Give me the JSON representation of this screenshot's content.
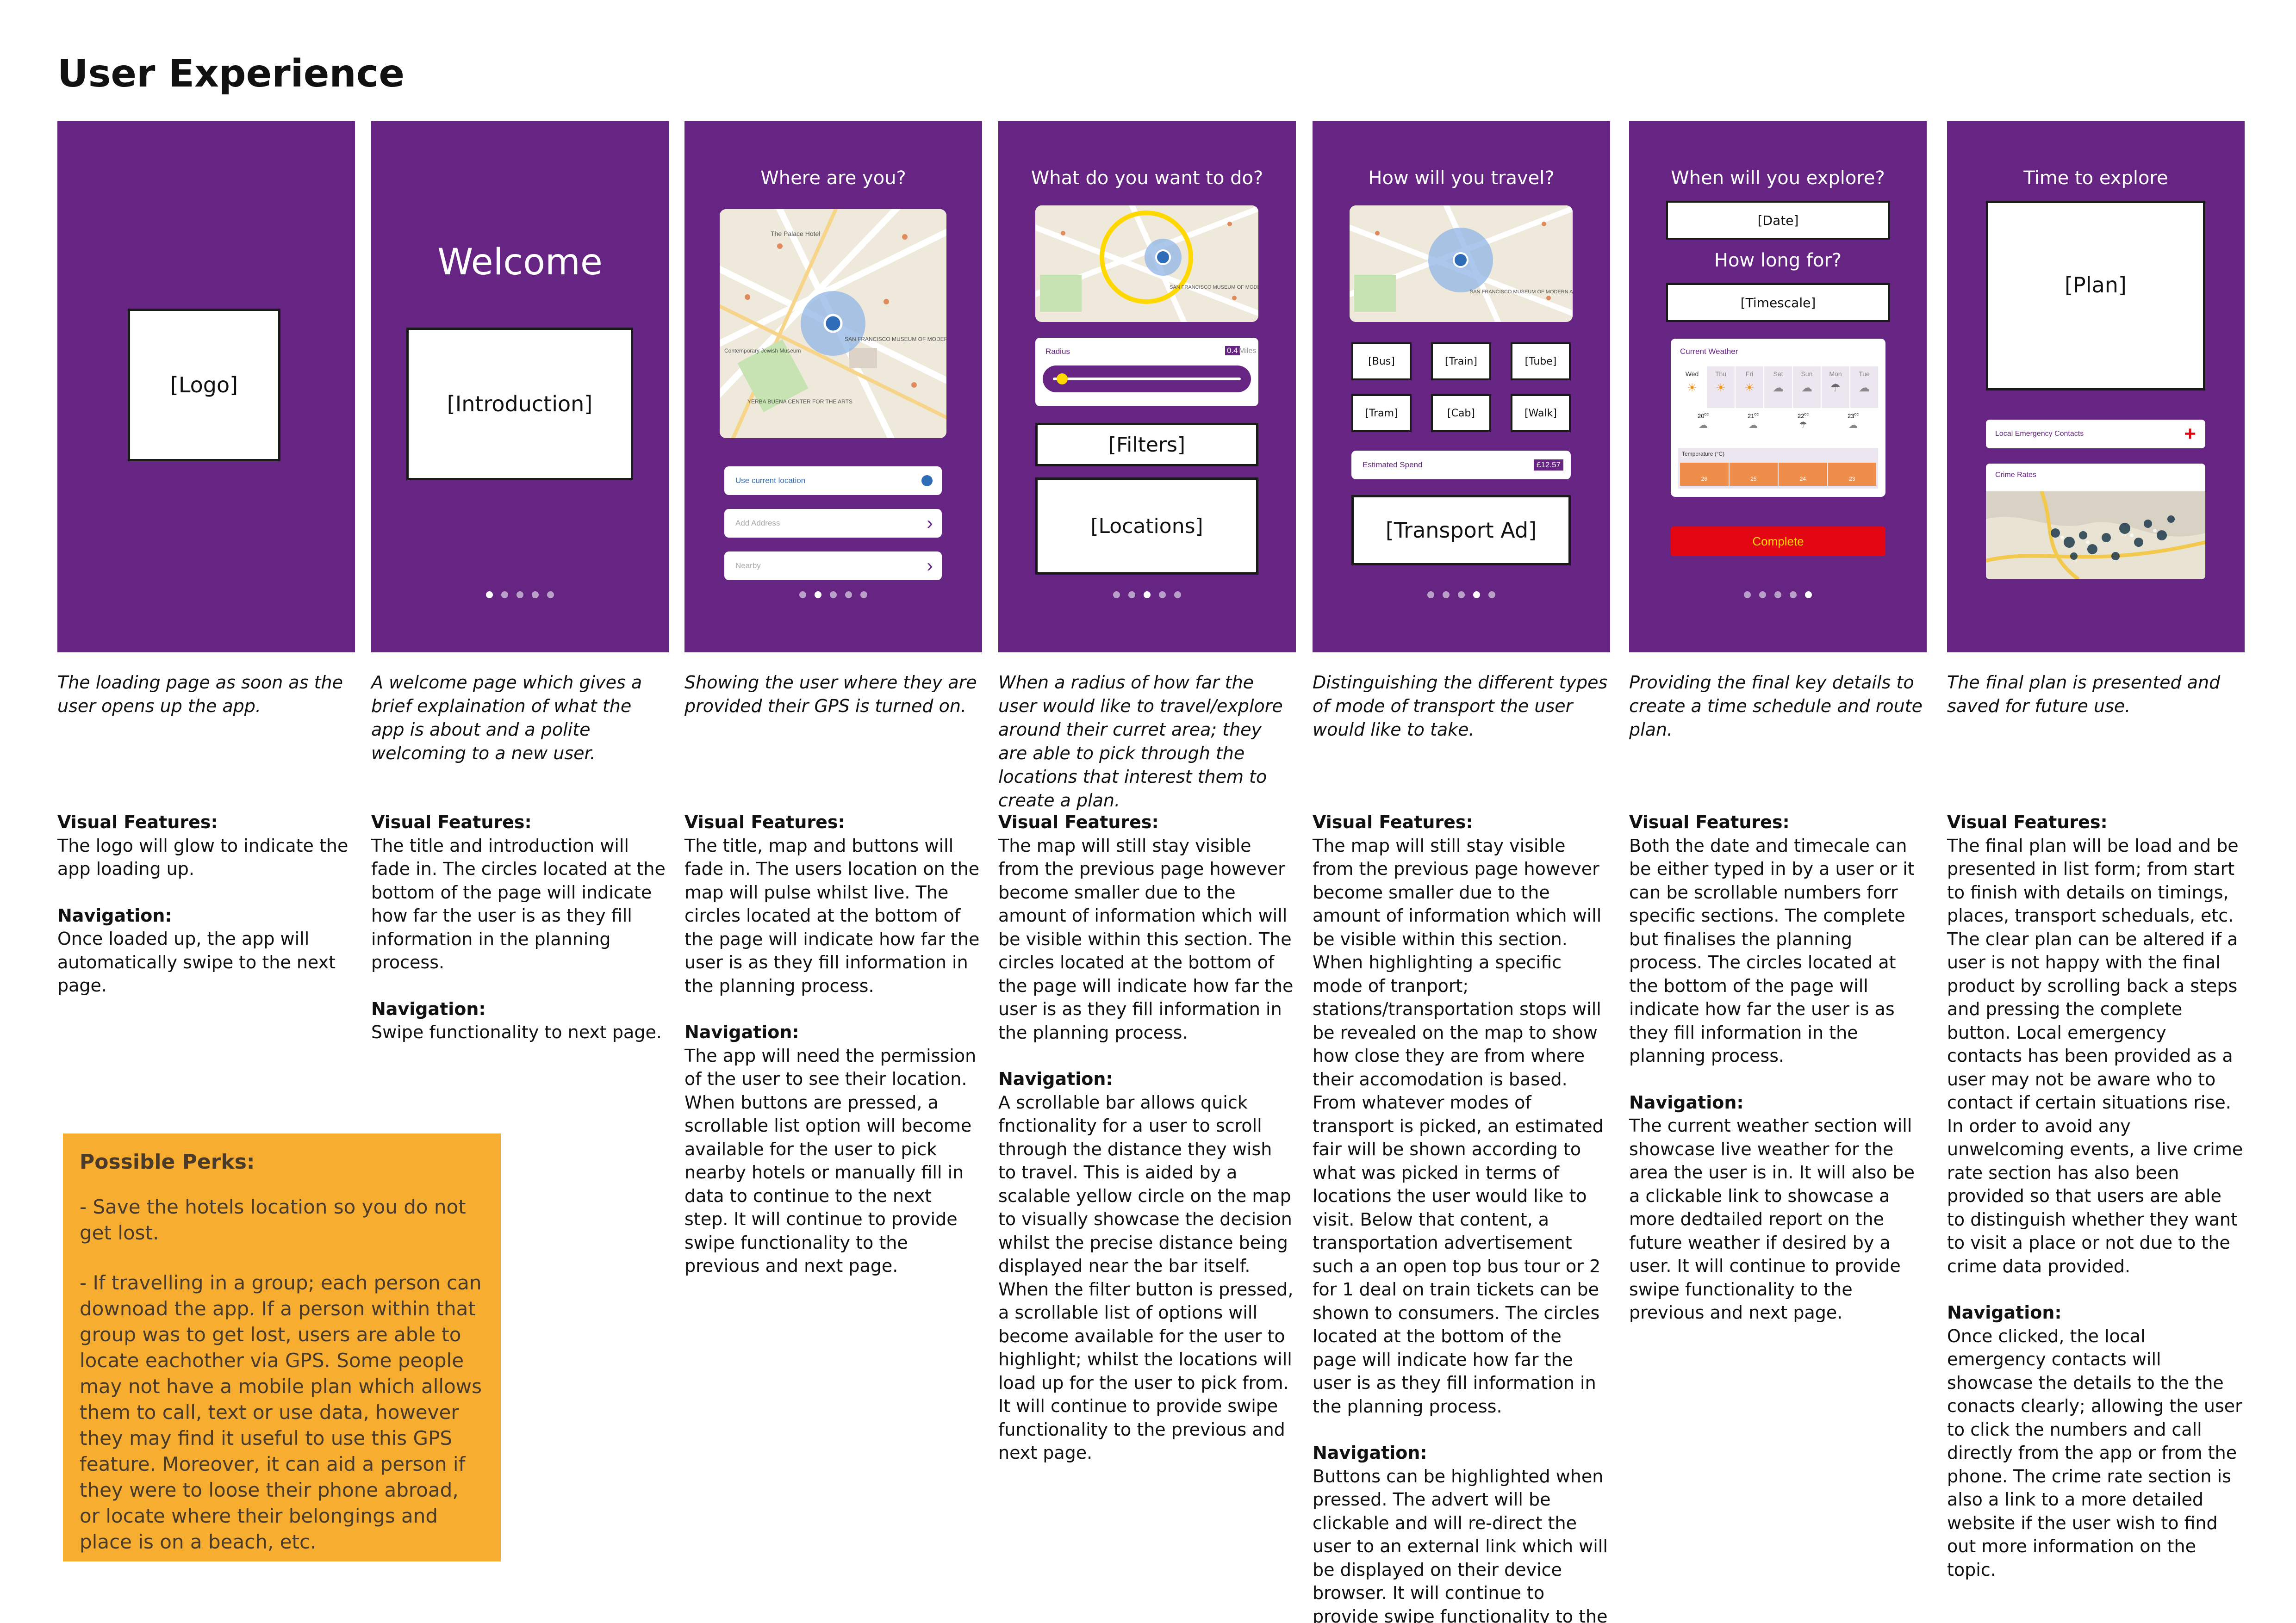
{
  "title": "User Experience",
  "screens": [
    {
      "placeholder": "[Logo]"
    },
    {
      "heading": "Welcome",
      "placeholder": "[Introduction]"
    },
    {
      "heading": "Where are you?",
      "use_location": "Use current location",
      "add_address": "Add Address",
      "nearby": "Nearby"
    },
    {
      "heading": "What do you want to do?",
      "radius_label": "Radius",
      "radius_value": "0.4",
      "radius_unit": "Miles",
      "radius_fraction": 0.05,
      "filters": "[Filters]",
      "locations": "[Locations]"
    },
    {
      "heading": "How will you travel?",
      "modes": [
        "[Bus]",
        "[Train]",
        "[Tube]",
        "[Tram]",
        "[Cab]",
        "[Walk]"
      ],
      "spend_label": "Estimated Spend",
      "spend_value": "£12.57",
      "ad": "[Transport Ad]"
    },
    {
      "heading": "When will you explore?",
      "date": "[Date]",
      "subheading": "How long for?",
      "timescale": "[Timescale]",
      "weather_title": "Current Weather",
      "days": [
        "Wed",
        "Thu",
        "Fri",
        "Sat",
        "Sun",
        "Mon",
        "Tue"
      ],
      "temps": [
        "20",
        "21",
        "22",
        "23"
      ],
      "temp_unit": "oc",
      "temp_label": "Temperature (°C)",
      "temp_bars": [
        "26",
        "25",
        "24",
        "23"
      ],
      "complete": "Complete"
    },
    {
      "heading": "Time to explore",
      "plan": "[Plan]",
      "emergency": "Local Emergency Contacts",
      "crime": "Crime Rates"
    }
  ],
  "map_labels": {
    "museum": "SAN FRANCISCO MUSEUM OF MODERN ART",
    "garden": "YERBA BUENA CENTER FOR THE ARTS",
    "palace": "The Palace Hotel",
    "contemporary": "Contemporary Jewish Museum"
  },
  "descriptions": [
    "The loading page as soon as the user opens up the app.",
    "A welcome page which gives a brief explaination of what the app is about and a polite welcoming to a new user.",
    "Showing the user where they are provided their GPS is turned on.",
    "When a radius of how far the user would like to travel/explore around their curret area; they are able to pick through the locations that interest them to create a plan.",
    "Distinguishing the different types of mode of transport the user would like to take.",
    "Providing the final key details to create a time schedule and route plan.",
    "The final plan is presented and saved for future use."
  ],
  "headings": {
    "visual": "Visual Features:",
    "navigation": "Navigation:"
  },
  "notes": [
    {
      "visual": "The logo will glow to indicate the app loading up.",
      "navigation": "Once loaded up, the app will automatically swipe to the next page."
    },
    {
      "visual": "The title and introduction will fade in. The circles located at the bottom of the page will indicate how far the user is as they fill information in the planning process.",
      "navigation": "Swipe functionality to next page."
    },
    {
      "visual": "The title, map and buttons will fade in. The users location on the map will pulse whilst live. The circles located at the bottom of the page will indicate how far the user is as they fill information in the planning process.",
      "navigation": "The app will need the permission of the user to see their location. When buttons are pressed, a scrollable list option will become available for the user to pick nearby hotels or manually fill in data to continue to the next step. It will continue to provide swipe functionality to the previous and next page."
    },
    {
      "visual": "The map will still stay visible from the previous page however become smaller due to the amount of information which will be visible within this section.  The circles located at the bottom of the page will indicate how far the user is as they fill information in the planning process.",
      "navigation": "A scrollable bar allows quick fnctionality for a user to scroll through the distance they wish to travel. This is aided by a scalable yellow circle on the map to visually showcase the decision whilst the precise distance being displayed near the bar itself. When the filter button is pressed, a scrollable list of options will become available for the user to highlight; whilst the locations will load up for the user to pick from. It will continue to provide swipe functionality to the previous and next page."
    },
    {
      "visual": "The map will still stay visible from the previous page however become smaller due to the amount of information which will be visible within this section. When highlighting a specific mode of tranport; stations/transportation stops will be revealed on the map to show how close they are from where their accomodation is based. From whatever modes of transport is picked, an estimated fair will be shown according to what was picked in terms of locations the user would like to visit. Below that content, a transportation advertisement such a an open top bus tour or 2 for 1 deal on train tickets can be shown to consumers. The circles located at the bottom of the page will indicate how far the user is as they fill information in the planning process.",
      "navigation": "Buttons can be highlighted when pressed. The advert will be clickable and will re-direct the user to an external link which will be displayed on their device browser.  It will continue to provide swipe functionality to the previous and next page."
    },
    {
      "visual": "Both the date and timecale can be either typed in by a user or it can be scrollable numbers forr specific sections. The complete but finalises the planning process. The circles located at the bottom of the page will indicate how far the user is as they fill information in the planning process.",
      "navigation": "The current weather section will showcase live weather for the area the user is in. It will also be a clickable link to showcase a more dedtailed report on the future weather if desired by a user. It will continue to provide swipe functionality to the previous and next page."
    },
    {
      "visual": "The final plan will be load and be presented in list form; from start to finish with details on timings, places, transport scheduals, etc. The clear plan can be altered if a user is not happy with the final product by scrolling back a steps and pressing the complete button. Local emergency contacts has been provided as a user may not be aware who to contact if certain situations rise. In order to avoid any unwelcoming events, a live crime rate section has also been provided so that users are able to distinguish whether they want to visit a place or not due to the crime data provided.",
      "navigation": "Once clicked, the local emergency contacts will showcase the details to the the conacts clearly; allowing the user to click the numbers and call directly from the app or from the phone. The crime rate section is also a link to a more detailed website if the user wish to find out more information on the topic."
    }
  ],
  "perks": {
    "title": "Possible Perks:",
    "items": [
      "- Save the hotels location so you do not get lost.",
      "- If travelling in a group; each person can downoad the app. If a person within that group was to get lost, users are able to locate eachother via GPS. Some people may not have a mobile plan which allows them to call, text or use data, however they may find it useful to use this GPS feature. Moreover, it can aid a person if they were to loose their phone abroad, or locate where their belongings and place is on a beach, etc."
    ]
  },
  "colors": {
    "purple": "#662483",
    "orange": "#f7ad2f",
    "red": "#e30613",
    "yellow": "#ffd800",
    "blue": "#2f6db8"
  }
}
